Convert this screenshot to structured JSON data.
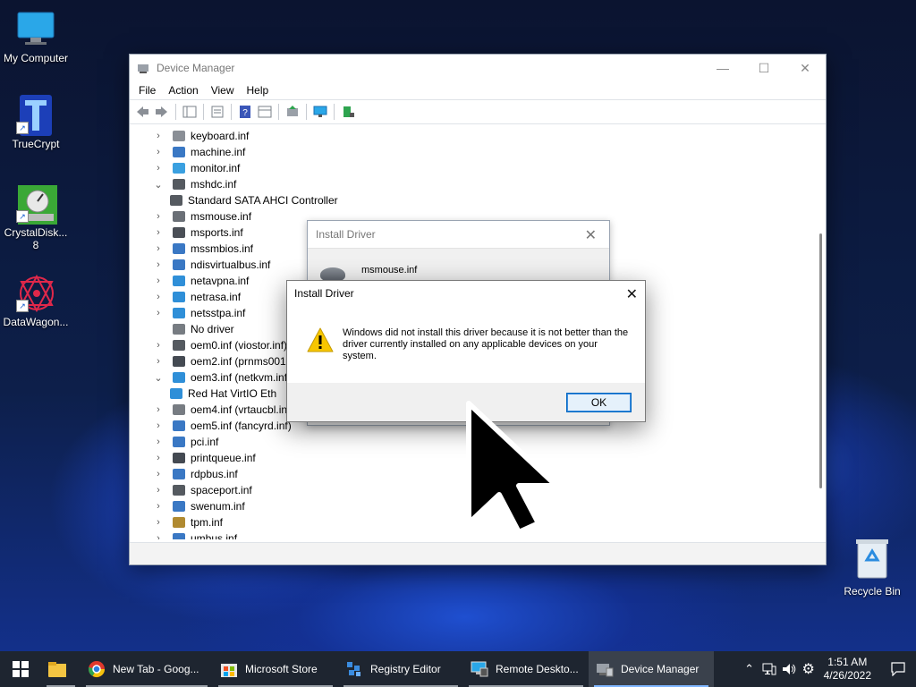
{
  "desktop": {
    "icons": [
      {
        "label": "My Computer"
      },
      {
        "label": "TrueCrypt"
      },
      {
        "label": "CrystalDisk...\n8"
      },
      {
        "label": "DataWagon..."
      }
    ],
    "recycle_bin": "Recycle Bin"
  },
  "window": {
    "title": "Device Manager",
    "controls": {
      "minimize": "—",
      "maximize": "☐",
      "close": "✕"
    },
    "menu": [
      "File",
      "Action",
      "View",
      "Help"
    ],
    "tree": [
      {
        "label": "keyboard.inf",
        "chev": ">",
        "icon_color": "#8a8f96"
      },
      {
        "label": "machine.inf",
        "chev": ">",
        "icon_color": "#3a78c4"
      },
      {
        "label": "monitor.inf",
        "chev": ">",
        "icon_color": "#3aa0e0"
      },
      {
        "label": "mshdc.inf",
        "chev": "v",
        "icon_color": "#555a60"
      },
      {
        "label": "Standard SATA AHCI Controller",
        "chev": "",
        "icon_color": "#555a60",
        "indent": true
      },
      {
        "label": "msmouse.inf",
        "chev": ">",
        "icon_color": "#6a6f76"
      },
      {
        "label": "msports.inf",
        "chev": ">",
        "icon_color": "#4a4f56"
      },
      {
        "label": "mssmbios.inf",
        "chev": ">",
        "icon_color": "#3a78c4"
      },
      {
        "label": "ndisvirtualbus.inf",
        "chev": ">",
        "icon_color": "#3a78c4"
      },
      {
        "label": "netavpna.inf",
        "chev": ">",
        "icon_color": "#2f8fd8"
      },
      {
        "label": "netrasa.inf",
        "chev": ">",
        "icon_color": "#2f8fd8"
      },
      {
        "label": "netsstpa.inf",
        "chev": ">",
        "icon_color": "#2f8fd8"
      },
      {
        "label": "No driver",
        "chev": "",
        "icon_color": "#777c82"
      },
      {
        "label": "oem0.inf (viostor.inf)",
        "chev": ">",
        "icon_color": "#555a60"
      },
      {
        "label": "oem2.inf (prnms001.i",
        "chev": ">",
        "icon_color": "#444a52"
      },
      {
        "label": "oem3.inf (netkvm.inf)",
        "chev": "v",
        "icon_color": "#2f8fd8"
      },
      {
        "label": "Red Hat VirtIO Eth",
        "chev": "",
        "icon_color": "#2f8fd8",
        "indent": true
      },
      {
        "label": "oem4.inf (vrtaucbl.inf",
        "chev": ">",
        "icon_color": "#777c82"
      },
      {
        "label": "oem5.inf (fancyrd.inf)",
        "chev": ">",
        "icon_color": "#3a78c4"
      },
      {
        "label": "pci.inf",
        "chev": ">",
        "icon_color": "#3a78c4"
      },
      {
        "label": "printqueue.inf",
        "chev": ">",
        "icon_color": "#444a52"
      },
      {
        "label": "rdpbus.inf",
        "chev": ">",
        "icon_color": "#3a78c4"
      },
      {
        "label": "spaceport.inf",
        "chev": ">",
        "icon_color": "#555a60"
      },
      {
        "label": "swenum.inf",
        "chev": ">",
        "icon_color": "#3a78c4"
      },
      {
        "label": "tpm.inf",
        "chev": ">",
        "icon_color": "#b08a30"
      },
      {
        "label": "umbus.inf",
        "chev": ">",
        "icon_color": "#3a78c4"
      }
    ]
  },
  "dialog_back": {
    "title": "Install Driver",
    "filename": "msmouse.inf"
  },
  "dialog_front": {
    "title": "Install Driver",
    "message": "Windows did not install this driver because it is not better than the driver currently installed on any applicable devices on your system.",
    "ok_label": "OK"
  },
  "taskbar": {
    "items": [
      {
        "label": "",
        "icon": "folder-icon"
      },
      {
        "label": "New Tab - Goog...",
        "icon": "chrome-icon"
      },
      {
        "label": "Microsoft Store",
        "icon": "store-icon"
      },
      {
        "label": "Registry Editor",
        "icon": "registry-icon"
      },
      {
        "label": "Remote Deskto...",
        "icon": "remote-desktop-icon"
      },
      {
        "label": "Device Manager",
        "icon": "device-manager-icon",
        "active": true
      }
    ],
    "time": "1:51 AM",
    "date": "4/26/2022"
  },
  "colors": {
    "accent": "#0067c0",
    "taskbar": "#1e2530",
    "warning": "#f7c600"
  }
}
